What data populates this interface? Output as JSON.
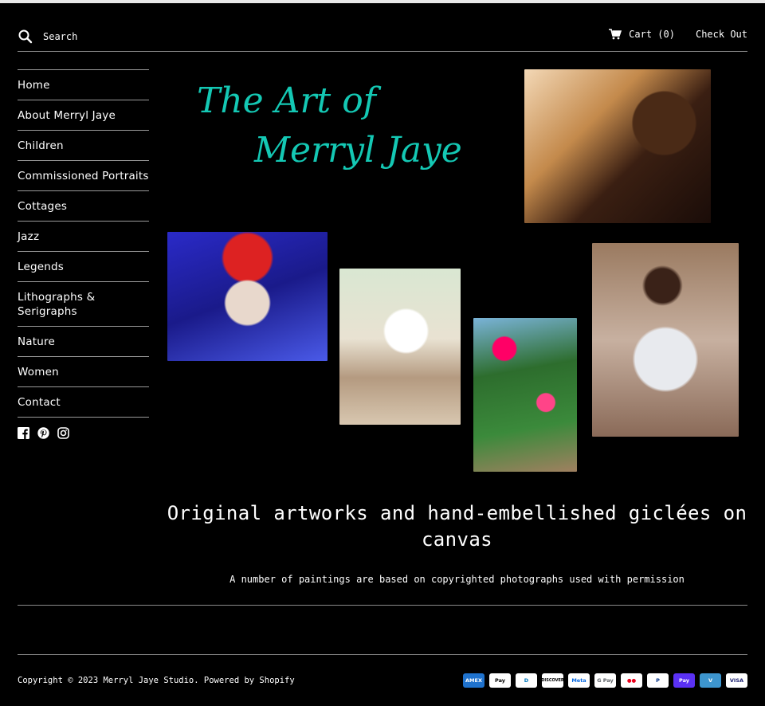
{
  "header": {
    "search_placeholder": "Search",
    "cart_label": "Cart (0)",
    "checkout_label": "Check Out"
  },
  "sidebar": {
    "items": [
      {
        "label": "Home"
      },
      {
        "label": "About Merryl Jaye"
      },
      {
        "label": "Children"
      },
      {
        "label": "Commissioned Portraits"
      },
      {
        "label": "Cottages"
      },
      {
        "label": "Jazz"
      },
      {
        "label": "Legends"
      },
      {
        "label": "Lithographs & Serigraphs"
      },
      {
        "label": "Nature"
      },
      {
        "label": "Women"
      },
      {
        "label": "Contact"
      }
    ],
    "social": [
      "facebook-icon",
      "pinterest-icon",
      "instagram-icon"
    ]
  },
  "hero": {
    "title_line1": "The Art of",
    "title_line2": "Merryl Jaye",
    "title_color": "#14c8b4"
  },
  "main": {
    "tagline": "Original artworks and hand-embellished giclées on canvas",
    "subline": "A number of paintings are based on copyrighted photographs used with permission"
  },
  "footer": {
    "copyright": "Copyright © 2023 Merryl Jaye Studio. Powered by Shopify",
    "payments": [
      "American Express",
      "Apple Pay",
      "Diners Club",
      "Discover",
      "Meta Pay",
      "Google Pay",
      "Mastercard",
      "PayPal",
      "Shop Pay",
      "Venmo",
      "Visa"
    ],
    "payment_labels": [
      "AMEX",
      "Pay",
      "D",
      "DISCOVER",
      "Meta",
      "G Pay",
      "●●",
      "P",
      "Pay",
      "V",
      "VISA"
    ]
  }
}
